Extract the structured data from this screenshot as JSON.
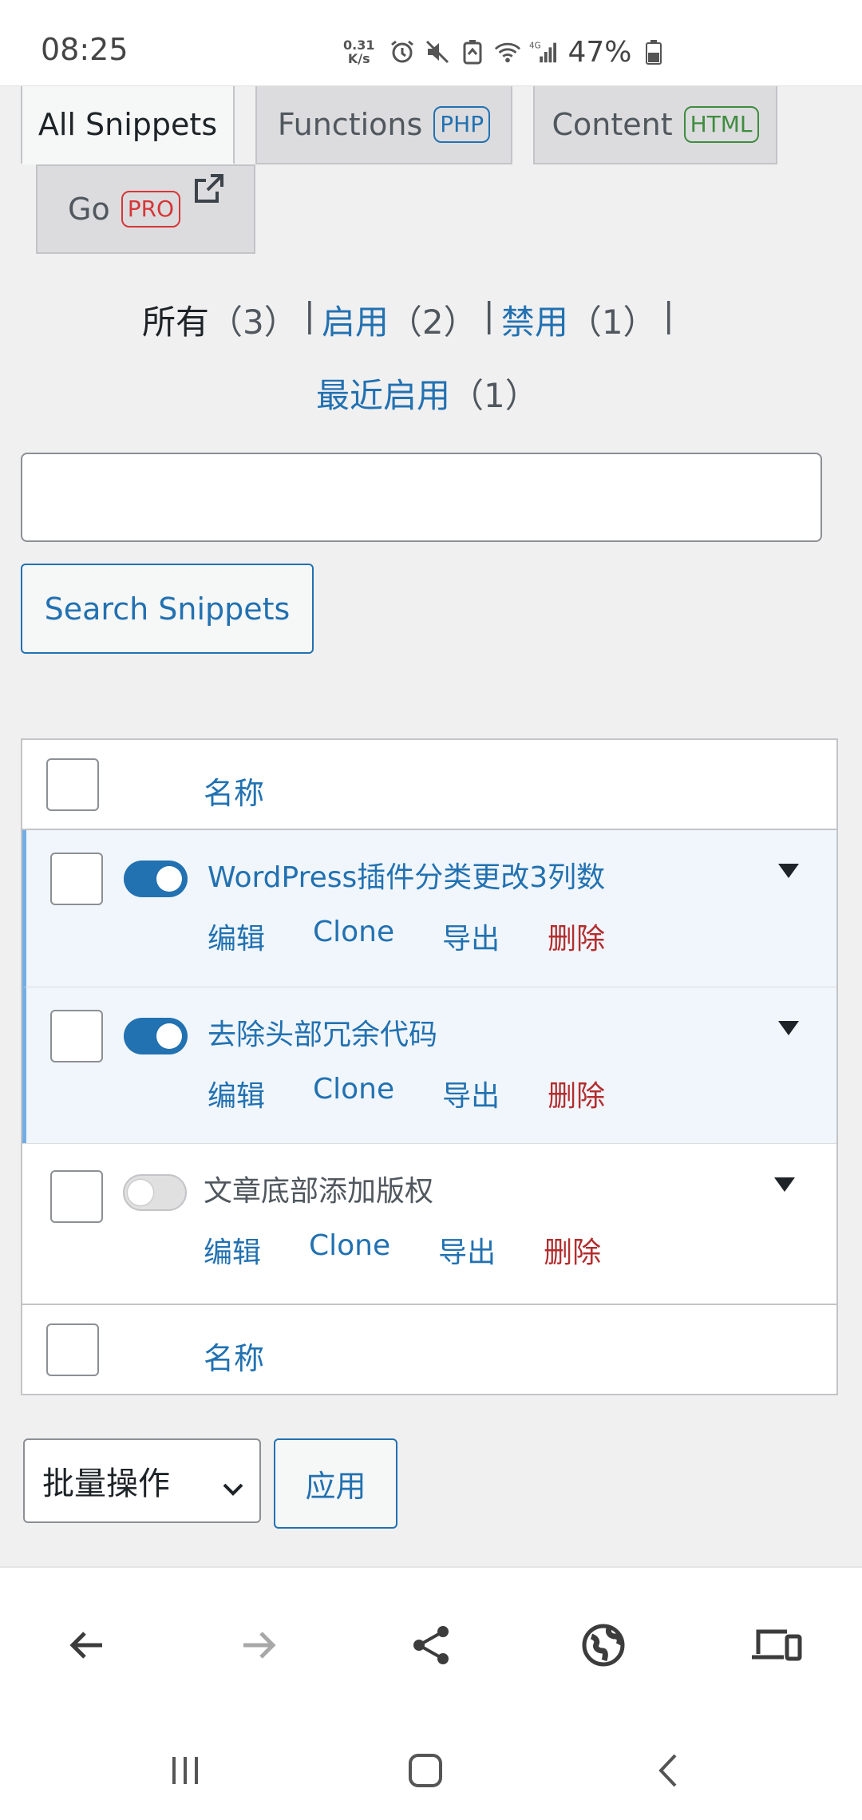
{
  "status_bar": {
    "time": "08:25",
    "net_speed_value": "0.31",
    "net_speed_unit": "K/s",
    "battery": "47%",
    "icons": [
      "alarm-icon",
      "mute-icon",
      "battery-saver-icon",
      "wifi-icon",
      "signal-4g-icon",
      "battery-icon"
    ]
  },
  "tabs": {
    "all": "All Snippets",
    "functions": "Functions",
    "functions_badge": "PHP",
    "content": "Content",
    "content_badge": "HTML",
    "go": "Go",
    "go_badge": "PRO"
  },
  "filters": {
    "all_label": "所有",
    "all_count": "（3）",
    "active_label": "启用",
    "active_count": "（2）",
    "inactive_label": "禁用",
    "inactive_count": "（1）",
    "recent_label": "最近启用",
    "recent_count": "（1）",
    "separator": "|"
  },
  "search": {
    "value": "",
    "button_label": "Search Snippets"
  },
  "table": {
    "column_name": "名称",
    "rows": [
      {
        "title": "WordPress插件分类更改3列数",
        "active": true
      },
      {
        "title": "去除头部冗余代码",
        "active": true
      },
      {
        "title": "文章底部添加版权",
        "active": false
      }
    ],
    "actions": {
      "edit": "编辑",
      "clone": "Clone",
      "export": "导出",
      "delete": "删除"
    }
  },
  "bulk": {
    "select_value": "批量操作",
    "apply_label": "应用"
  },
  "colors": {
    "link": "#2271b1",
    "delete": "#b32d2e",
    "php_badge": "#2271b1",
    "html_badge": "#3e8c3e",
    "pro_badge": "#d63638",
    "active_row_bg": "#f0f6fc"
  },
  "browser_bar": {
    "icons": [
      "back-arrow-icon",
      "forward-arrow-icon",
      "share-icon",
      "globe-icon",
      "devices-icon"
    ]
  },
  "nav_bar": {
    "icons": [
      "recent-apps-icon",
      "home-icon",
      "back-icon"
    ]
  }
}
